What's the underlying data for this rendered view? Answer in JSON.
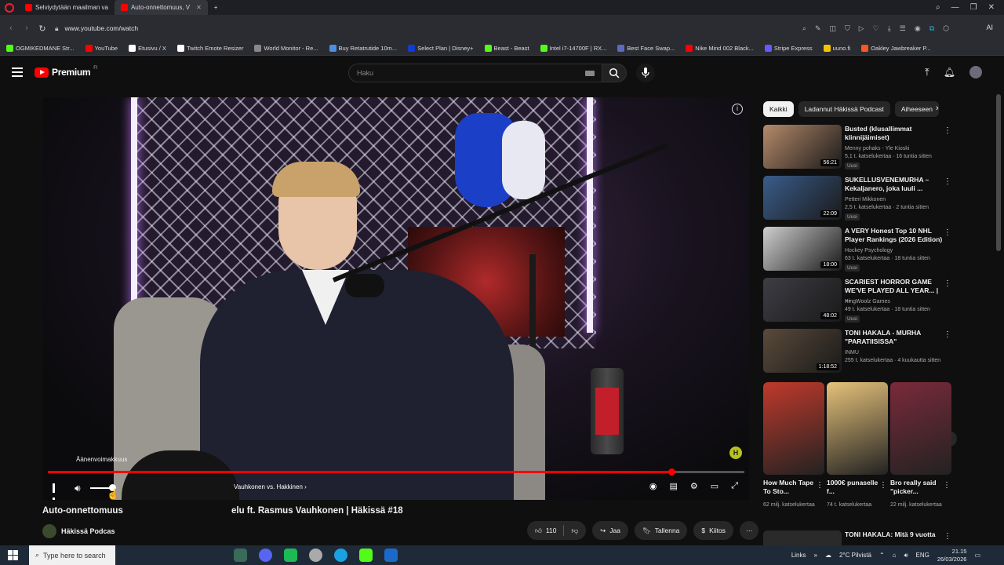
{
  "browser": {
    "tabs": [
      {
        "label": "Selviydytään maailman va",
        "active": false
      },
      {
        "label": "Auto-onnettomuus, V",
        "active": true
      }
    ],
    "new_tab": "+",
    "url": "www.youtube.com/watch",
    "bookmarks": [
      {
        "label": "OGMIKEDMANE Str...",
        "color": "#53fc18"
      },
      {
        "label": "YouTube",
        "color": "#ff0000"
      },
      {
        "label": "Etusivu / X",
        "color": "#ffffff"
      },
      {
        "label": "Twitch Emote Resizer",
        "color": "#ffffff"
      },
      {
        "label": "World Monitor - Re...",
        "color": "#888888"
      },
      {
        "label": "Buy Retatrutide 10m...",
        "color": "#4a90e2"
      },
      {
        "label": "Select Plan | Disney+",
        "color": "#113ccf"
      },
      {
        "label": "Beast - Beast",
        "color": "#53fc18"
      },
      {
        "label": "Intel i7-14700F | RX...",
        "color": "#53fc18"
      },
      {
        "label": "Best Face Swap...",
        "color": "#5c6bc0"
      },
      {
        "label": "Nike Mind 002 Black...",
        "color": "#ff0000"
      },
      {
        "label": "Stripe Express",
        "color": "#635bff"
      },
      {
        "label": "uuno.fi",
        "color": "#f5c400"
      },
      {
        "label": "Oakley Jawbreaker P...",
        "color": "#ff5722"
      }
    ],
    "extension_label": "AI"
  },
  "youtube": {
    "logo_text": "Premium",
    "logo_sup": "FI",
    "search_placeholder": "Haku"
  },
  "player": {
    "tooltip": "Äänenvoimakkuus",
    "chapter": "Vauhkonen vs. Hakkinen",
    "progress_fraction": 0.895,
    "volume_fraction": 0.85,
    "watermark": "H"
  },
  "video": {
    "title_left": "Auto-onnettomuus",
    "title_right": "elu ft. Rasmus Vauhkonen | Häkissä #18",
    "channel": "Häkissä Podcas",
    "likes": "110",
    "share": "Jaa",
    "save": "Tallenna",
    "thanks": "Kiitos"
  },
  "sidebar": {
    "chips": [
      "Kaikki",
      "Ladannut Häkissä Podcast",
      "Aiheeseen"
    ],
    "recommendations": [
      {
        "title": "Busted (klusallimmat klinnijäimiset)",
        "channel": "Menny pohaks - Yle Kioski",
        "meta": "5,1 t. katselukertaa · 16 tuntia sitten",
        "badge": "Uusi",
        "duration": "56:21",
        "color": "#b58a6a"
      },
      {
        "title": "SUKELLUSVENEMURHA – Kekaljanero, joka luuli ...",
        "channel": "Petteri Mikkonen",
        "meta": "2,5 t. katselukertaa · 2 tuntia sitten",
        "badge": "Uusi",
        "duration": "22:09",
        "color": "#3a5c8a"
      },
      {
        "title": "A VERY Honest Top 10 NHL Player Rankings (2026 Edition)",
        "channel": "Hockey Psychology",
        "meta": "63 t. katselukertaa · 18 tuntia sitten",
        "badge": "Uusi",
        "duration": "18:00",
        "color": "#cfcfcf"
      },
      {
        "title": "SCARIEST HORROR GAME WE'VE PLAYED ALL YEAR... | ...",
        "channel": "KingWoolz Games",
        "meta": "49 t. katselukertaa · 18 tuntia sitten",
        "badge": "Uusi",
        "duration": "48:02",
        "color": "#3d3d44"
      },
      {
        "title": "TONI HAKALA - MURHA \"PARATIISISSA\"",
        "channel": "INMU",
        "meta": "255 t. katselukertaa · 4 kuukautta sitten",
        "badge": "",
        "duration": "1:18:52",
        "color": "#5a4a3a"
      }
    ],
    "shorts": [
      {
        "title": "How Much Tape To Sto...",
        "views": "62 milj. katselukertaa",
        "color": "#c0392b"
      },
      {
        "title": "1000€ punaselle f...",
        "views": "74 t. katselukertaa",
        "color": "#e6c27a"
      },
      {
        "title": "Bro really said \"picker...",
        "views": "22 milj. katselukertaa",
        "color": "#7a2a3a"
      }
    ],
    "last_rec_title": "TONI HAKALA: Mitä 9 vuotta"
  },
  "taskbar": {
    "search_placeholder": "Type here to search",
    "links": "Links",
    "weather": "2°C Pilvistä",
    "lang": "ENG",
    "time": "21.15",
    "date": "26/03/2026"
  }
}
